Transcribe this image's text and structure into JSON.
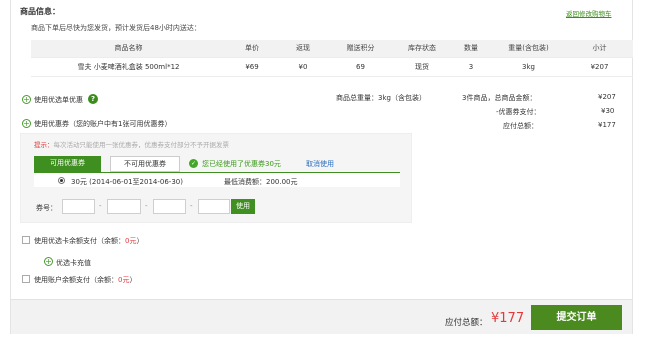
{
  "section": {
    "title": "商品信息：",
    "back_link": "返回修改购物车",
    "note": "商品下单后尽快为您发货，预计发货后48小时内送达："
  },
  "goods_table": {
    "headers": [
      "商品名称",
      "单价",
      "返现",
      "赠送积分",
      "库存状态",
      "数量",
      "重量(含包装)",
      "小计"
    ],
    "rows": [
      [
        "雪夫 小麦啤酒礼盒装 500ml*12",
        "¥69",
        "¥0",
        "69",
        "现货",
        "3",
        "3kg",
        "¥207"
      ]
    ]
  },
  "options": {
    "order_coupon": "使用优选单优惠",
    "help_icon": "?",
    "coupon": "使用优惠券（您的账户中有1张可用优惠券）"
  },
  "summary": {
    "total_weight": "商品总重量：3kg（含包装）",
    "goods_total_label": "3件商品，总商品金额：",
    "goods_total_value": "¥207",
    "discount_label": "-优惠券支付：",
    "discount_value": "¥30",
    "payable_label": "应付总额：",
    "payable_value": "¥177"
  },
  "coupon_panel": {
    "tip_label": "提示：",
    "tip_text": "每次活动只能使用一张优惠券，优惠券支付部分不予开据发票",
    "tab_available": "可用优惠券",
    "tab_unavailable": "不可用优惠券",
    "used_text": "您已经使用了优惠券30元",
    "cancel_text": "取消使用",
    "coupon_item": "30元 (2014-06-01至2014-06-30)",
    "min_spend": "最低消费额：200.00元",
    "code_label": "券号：",
    "sep": "-",
    "use_button": "使用"
  },
  "balance": {
    "card_label": "使用优选卡余额支付（余额：",
    "card_amount": "0元",
    "card_close": "）",
    "recharge": "优选卡充值",
    "account_label": "使用账户余额支付（余额：",
    "account_amount": "0元",
    "account_close": "）"
  },
  "footer": {
    "payable_label": "应付总额：",
    "payable_value": "¥177",
    "submit": "提交订单"
  },
  "colors": {
    "accent_green": "#3e8f20",
    "price_red": "#e4393c"
  }
}
